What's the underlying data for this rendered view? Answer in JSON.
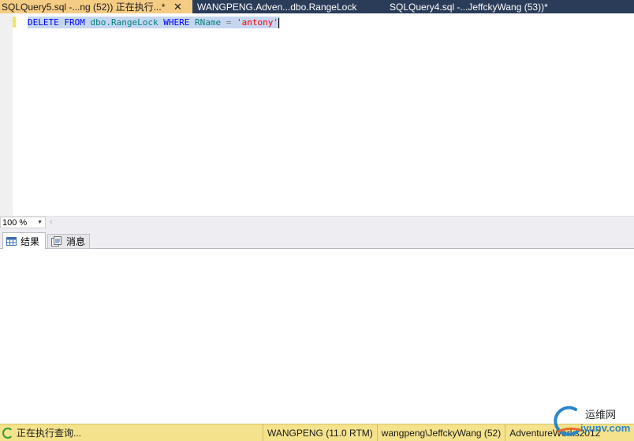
{
  "tabs": [
    {
      "label": "SQLQuery5.sql -...ng (52)) 正在执行...*",
      "active": true,
      "close": "✕"
    },
    {
      "label": "WANGPENG.Adven...dbo.RangeLock",
      "active": false
    },
    {
      "label": "SQLQuery4.sql -...JeffckyWang (53))*",
      "active": false
    }
  ],
  "editor": {
    "tokens": {
      "delete": "DELETE",
      "from": "FROM",
      "table": "dbo.RangeLock",
      "where": "WHERE",
      "column": "RName",
      "equals": "=",
      "value": "'antony'"
    }
  },
  "zoom": {
    "value": "100 %"
  },
  "results_tabs": [
    {
      "label": "结果",
      "icon": "grid-icon",
      "active": true
    },
    {
      "label": "消息",
      "icon": "messages-icon",
      "active": false
    }
  ],
  "status": {
    "executing": "正在执行查询...",
    "server": "WANGPENG (11.0 RTM)",
    "user": "wangpeng\\JeffckyWang (52)",
    "database": "AdventureWorks2012"
  },
  "watermark": {
    "text": "运维网",
    "url": "iyunv.com"
  },
  "colors": {
    "tabstrip": "#2b3c59",
    "active_tab": "#f5cc84",
    "keyword": "#0000ff",
    "identifier": "#008080",
    "string": "#ff0000",
    "selection": "#c5d6f0",
    "statusbar": "#f5e28c"
  }
}
